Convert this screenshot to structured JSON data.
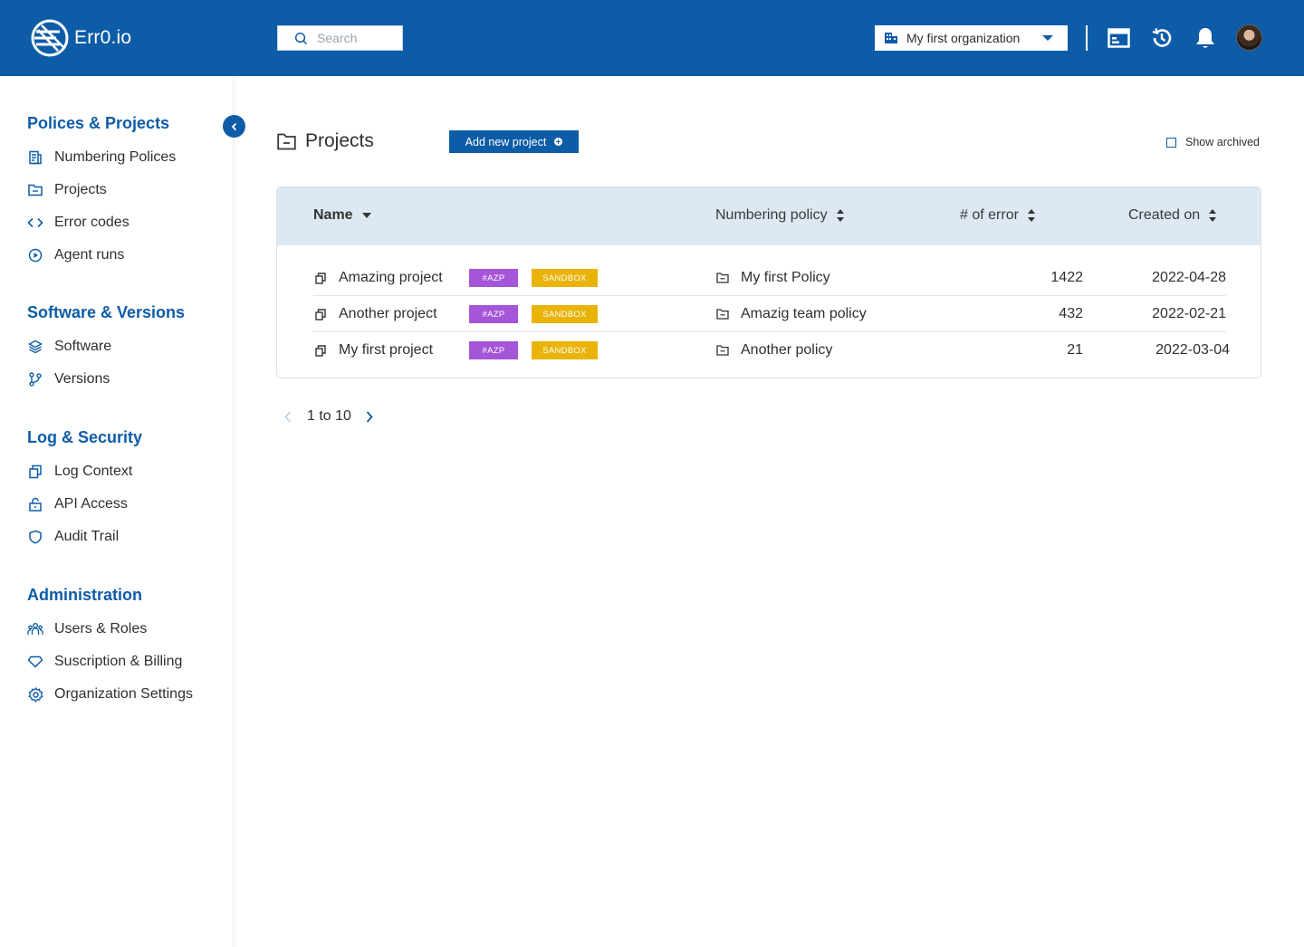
{
  "app": {
    "brand": "Err0.io"
  },
  "header": {
    "search_placeholder": "Search",
    "org_name": "My first organization"
  },
  "sidebar": {
    "sections": [
      {
        "title": "Polices & Projects",
        "items": [
          "Numbering Polices",
          "Projects",
          "Error codes",
          "Agent runs"
        ]
      },
      {
        "title": "Software & Versions",
        "items": [
          "Software",
          "Versions"
        ]
      },
      {
        "title": "Log & Security",
        "items": [
          "Log Context",
          "API Access",
          "Audit Trail"
        ]
      },
      {
        "title": "Administration",
        "items": [
          "Users & Roles",
          "Suscription & Billing",
          "Organization Settings"
        ]
      }
    ]
  },
  "main": {
    "title": "Projects",
    "add_button": "Add new project",
    "show_archived": "Show archived",
    "table": {
      "columns": [
        "Name",
        "Numbering policy",
        "# of error",
        "Created on"
      ],
      "rows": [
        {
          "name": "Amazing project",
          "tag1": "#AZP",
          "tag2": "SANDBOX",
          "policy": "My first Policy",
          "errors": "1422",
          "created": "2022-04-28"
        },
        {
          "name": "Another project",
          "tag1": "#AZP",
          "tag2": "SANDBOX",
          "policy": "Amazig team policy",
          "errors": "432",
          "created": "2022-02-21"
        },
        {
          "name": "My first project",
          "tag1": "#AZP",
          "tag2": "SANDBOX",
          "policy": "Another policy",
          "errors": "21",
          "created": "2022-03-04"
        }
      ]
    },
    "pagination": "1 to 10"
  },
  "colors": {
    "brand": "#0d5ca8",
    "tag_purple": "#a455d8",
    "tag_yellow": "#eab308",
    "header_row": "#dde8f3"
  }
}
